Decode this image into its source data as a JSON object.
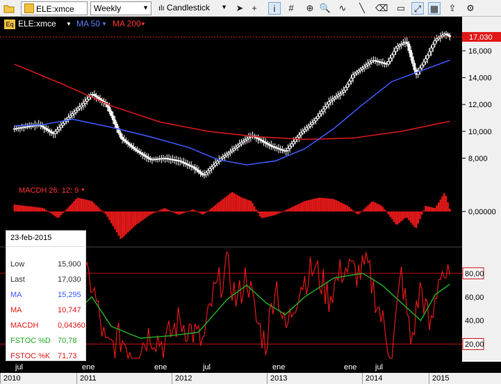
{
  "toolbar": {
    "symbol": "ELE:xmce",
    "period": "Weekly",
    "chart_type": "Candlestick",
    "tools": [
      {
        "icon": "cursor-arrow-icon"
      },
      {
        "icon": "crosshair-icon"
      },
      {
        "icon": "info-icon"
      },
      {
        "icon": "grid-icon"
      },
      {
        "icon": "zoom-icon"
      },
      {
        "icon": "magnifier-icon"
      },
      {
        "icon": "wave-icon"
      },
      {
        "icon": "draw-line-icon"
      },
      {
        "icon": "erase-icon"
      },
      {
        "icon": "eraser-icon"
      },
      {
        "icon": "expand-icon"
      },
      {
        "icon": "pattern-icon"
      },
      {
        "icon": "export-icon"
      },
      {
        "icon": "chart-settings-icon"
      }
    ]
  },
  "legend": {
    "eq_badge": "Eq",
    "symbol": "ELE:xmce",
    "ma50": "MA 50",
    "ma200": "MA 200",
    "macdh": "MACDH 26: 12: 9"
  },
  "colors": {
    "price": "#ffffff",
    "ma50": "#3c5cff",
    "ma200": "#e01818",
    "macd": "#e01818",
    "stoch_d": "#22aa22",
    "stoch_k": "#e01818"
  },
  "price_axis": {
    "ticks": [
      "8,000",
      "10,000",
      "12,000",
      "14,000",
      "16,000"
    ],
    "last_price": "17,030",
    "macd_tick": "0,00000",
    "stoch_ticks": [
      "20,00",
      "40,00",
      "60,00",
      "80,00"
    ]
  },
  "x_axis": {
    "months": [
      "jul",
      "ene",
      "ene",
      "jul",
      "ene",
      "ene",
      "jul"
    ],
    "years": [
      "2010",
      "2011",
      "2012",
      "2013",
      "2014",
      "2015"
    ]
  },
  "info": {
    "date": "23-feb-2015",
    "rows": [
      {
        "label": "Low",
        "value": "15,900",
        "color": "#333333"
      },
      {
        "label": "Last",
        "value": "17,030",
        "color": "#333333"
      },
      {
        "label": "MA",
        "value": "15,295",
        "color": "#3c5cff"
      },
      {
        "label": "MA",
        "value": "10,747",
        "color": "#e01818"
      },
      {
        "label": "MACDH",
        "value": "0,04360",
        "color": "#e01818"
      },
      {
        "label": "FSTOC %D",
        "value": "70,78",
        "color": "#22aa22"
      },
      {
        "label": "FSTOC %K",
        "value": "71,73",
        "color": "#e01818"
      }
    ]
  },
  "chart_data": {
    "type": "candlestick",
    "title": "",
    "xlabel": "",
    "ylabel": "",
    "price_ylim": [
      6000,
      17500
    ],
    "price_path": [
      [
        2010.5,
        10200
      ],
      [
        2010.75,
        10500
      ],
      [
        2010.9,
        9800
      ],
      [
        2011.05,
        11000
      ],
      [
        2011.2,
        12000
      ],
      [
        2011.3,
        12800
      ],
      [
        2011.45,
        12000
      ],
      [
        2011.6,
        9500
      ],
      [
        2011.75,
        8600
      ],
      [
        2011.9,
        7900
      ],
      [
        2012.05,
        8000
      ],
      [
        2012.2,
        7800
      ],
      [
        2012.35,
        7300
      ],
      [
        2012.45,
        6700
      ],
      [
        2012.6,
        7800
      ],
      [
        2012.75,
        8600
      ],
      [
        2012.85,
        9200
      ],
      [
        2012.95,
        9700
      ],
      [
        2013.05,
        9300
      ],
      [
        2013.15,
        8900
      ],
      [
        2013.3,
        8500
      ],
      [
        2013.45,
        9800
      ],
      [
        2013.6,
        10800
      ],
      [
        2013.75,
        12200
      ],
      [
        2013.9,
        13000
      ],
      [
        2014.0,
        14200
      ],
      [
        2014.2,
        15300
      ],
      [
        2014.35,
        15000
      ],
      [
        2014.45,
        16300
      ],
      [
        2014.55,
        16700
      ],
      [
        2014.65,
        14200
      ],
      [
        2014.75,
        15400
      ],
      [
        2014.85,
        16800
      ],
      [
        2014.95,
        17300
      ],
      [
        2015.0,
        17030
      ]
    ],
    "ma50": [
      [
        2010.5,
        10400
      ],
      [
        2010.8,
        10500
      ],
      [
        2011.1,
        10900
      ],
      [
        2011.5,
        10300
      ],
      [
        2011.9,
        9600
      ],
      [
        2012.3,
        8800
      ],
      [
        2012.6,
        7900
      ],
      [
        2012.9,
        7500
      ],
      [
        2013.2,
        7800
      ],
      [
        2013.5,
        8700
      ],
      [
        2013.8,
        10200
      ],
      [
        2014.1,
        12000
      ],
      [
        2014.4,
        13700
      ],
      [
        2014.7,
        14500
      ],
      [
        2015.0,
        15295
      ]
    ],
    "ma200": [
      [
        2010.5,
        15000
      ],
      [
        2011.0,
        13500
      ],
      [
        2011.5,
        11900
      ],
      [
        2012.0,
        10700
      ],
      [
        2012.5,
        10000
      ],
      [
        2013.0,
        9600
      ],
      [
        2013.5,
        9400
      ],
      [
        2014.0,
        9500
      ],
      [
        2014.5,
        10000
      ],
      [
        2015.0,
        10747
      ]
    ],
    "stoch_ylim": [
      5,
      100
    ],
    "stoch_k": [
      [
        2010.5,
        60
      ],
      [
        2010.65,
        30
      ],
      [
        2010.8,
        45
      ],
      [
        2010.95,
        10
      ],
      [
        2011.05,
        40
      ],
      [
        2011.15,
        80
      ],
      [
        2011.3,
        72
      ],
      [
        2011.45,
        15
      ],
      [
        2011.6,
        25
      ],
      [
        2011.75,
        12
      ],
      [
        2011.9,
        30
      ],
      [
        2012.05,
        20
      ],
      [
        2012.2,
        40
      ],
      [
        2012.35,
        30
      ],
      [
        2012.45,
        20
      ],
      [
        2012.55,
        60
      ],
      [
        2012.7,
        85
      ],
      [
        2012.8,
        55
      ],
      [
        2012.9,
        80
      ],
      [
        2013.0,
        40
      ],
      [
        2013.1,
        20
      ],
      [
        2013.2,
        75
      ],
      [
        2013.3,
        30
      ],
      [
        2013.45,
        70
      ],
      [
        2013.6,
        85
      ],
      [
        2013.75,
        60
      ],
      [
        2013.9,
        85
      ],
      [
        2014.05,
        80
      ],
      [
        2014.15,
        85
      ],
      [
        2014.3,
        40
      ],
      [
        2014.4,
        10
      ],
      [
        2014.5,
        80
      ],
      [
        2014.6,
        20
      ],
      [
        2014.7,
        70
      ],
      [
        2014.8,
        30
      ],
      [
        2014.9,
        85
      ],
      [
        2015.0,
        71.73
      ]
    ],
    "stoch_d": [
      [
        2010.5,
        55
      ],
      [
        2010.8,
        42
      ],
      [
        2011.0,
        38
      ],
      [
        2011.3,
        60
      ],
      [
        2011.5,
        35
      ],
      [
        2011.8,
        25
      ],
      [
        2012.1,
        27
      ],
      [
        2012.4,
        30
      ],
      [
        2012.7,
        58
      ],
      [
        2012.9,
        70
      ],
      [
        2013.1,
        55
      ],
      [
        2013.3,
        45
      ],
      [
        2013.5,
        60
      ],
      [
        2013.8,
        76
      ],
      [
        2014.1,
        80
      ],
      [
        2014.3,
        70
      ],
      [
        2014.5,
        55
      ],
      [
        2014.7,
        40
      ],
      [
        2014.85,
        62
      ],
      [
        2015.0,
        70.78
      ]
    ],
    "macd_ylim": [
      -0.5,
      0.35
    ],
    "macd_hist": [
      [
        2010.5,
        0.1
      ],
      [
        2010.8,
        0.05
      ],
      [
        2010.95,
        -0.1
      ],
      [
        2011.15,
        0.2
      ],
      [
        2011.3,
        0.15
      ],
      [
        2011.45,
        -0.05
      ],
      [
        2011.6,
        -0.4
      ],
      [
        2011.75,
        -0.2
      ],
      [
        2011.9,
        -0.05
      ],
      [
        2012.05,
        0.05
      ],
      [
        2012.2,
        -0.05
      ],
      [
        2012.35,
        0.03
      ],
      [
        2012.45,
        -0.05
      ],
      [
        2012.6,
        0.12
      ],
      [
        2012.75,
        0.28
      ],
      [
        2012.85,
        0.2
      ],
      [
        2012.95,
        0.15
      ],
      [
        2013.05,
        -0.1
      ],
      [
        2013.2,
        -0.05
      ],
      [
        2013.35,
        0.05
      ],
      [
        2013.5,
        0.15
      ],
      [
        2013.65,
        0.2
      ],
      [
        2013.8,
        0.18
      ],
      [
        2013.95,
        0.08
      ],
      [
        2014.05,
        -0.05
      ],
      [
        2014.2,
        0.15
      ],
      [
        2014.3,
        0.08
      ],
      [
        2014.45,
        -0.2
      ],
      [
        2014.55,
        -0.08
      ],
      [
        2014.65,
        -0.25
      ],
      [
        2014.75,
        0.08
      ],
      [
        2014.85,
        0.05
      ],
      [
        2014.95,
        0.28
      ],
      [
        2015.0,
        0.04
      ]
    ]
  }
}
